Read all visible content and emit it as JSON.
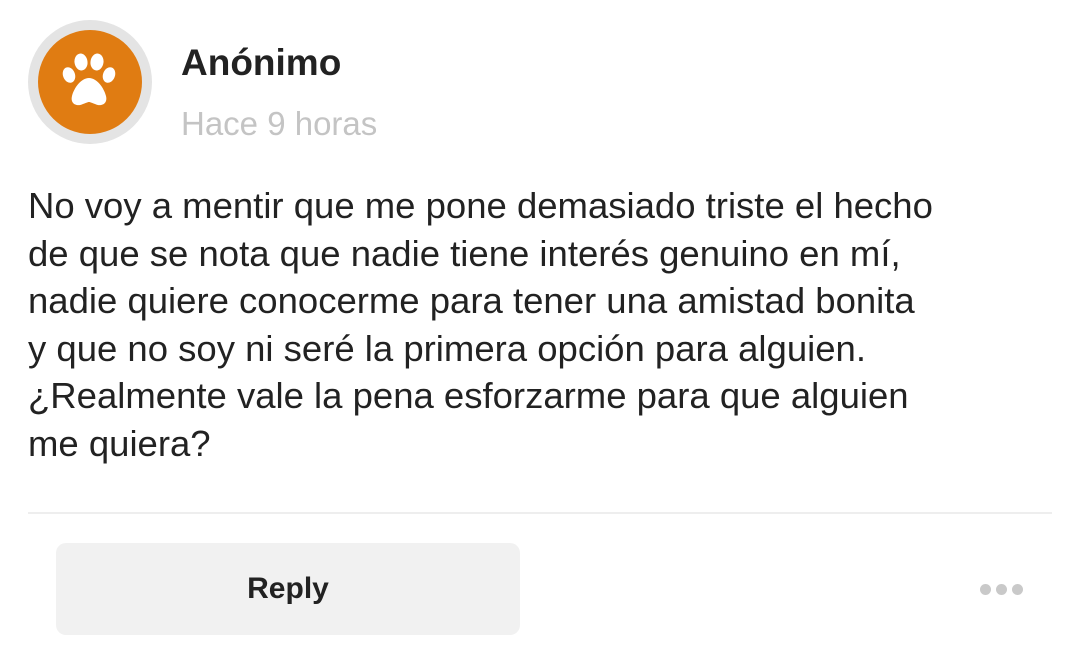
{
  "post": {
    "author": "Anónimo",
    "timestamp": "Hace 9 horas",
    "body": "No voy a mentir que me pone demasiado triste el hecho\nde que se nota que nadie tiene interés genuino en mí,\nnadie quiere conocerme para tener una amistad bonita\ny que no soy ni seré la primera opción para alguien.\n¿Realmente vale la pena esforzarme para que alguien\nme quiera?",
    "avatar": {
      "icon": "paw-icon",
      "background_color": "#e07c12",
      "ring_color": "#e4e4e4"
    }
  },
  "actions": {
    "reply_label": "Reply",
    "more_icon": "more-horizontal-icon"
  },
  "colors": {
    "text": "#222222",
    "muted": "#c4c4c4",
    "button_bg": "#f1f1f1"
  }
}
